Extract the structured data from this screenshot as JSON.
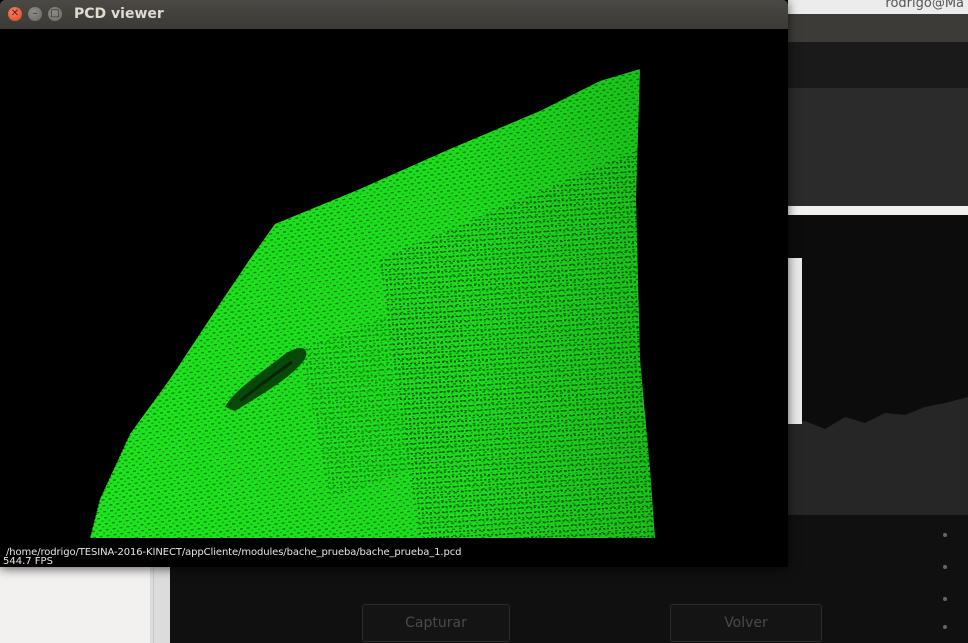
{
  "background_app": {
    "title": "rodrigo@Ma",
    "buttons": {
      "capturar": "Capturar",
      "volver": "Volver"
    }
  },
  "pcd_viewer": {
    "title": "PCD viewer",
    "window_controls": {
      "close_icon": "close-icon",
      "minimize_icon": "minimize-icon",
      "maximize_icon": "maximize-icon"
    },
    "file_path": "/home/rodrigo/TESINA-2016-KINECT/appCliente/modules/bache_prueba/bache_prueba_1.pcd",
    "fps": "544.7 FPS",
    "point_color": "#1fe61f",
    "background_color": "#000000"
  }
}
